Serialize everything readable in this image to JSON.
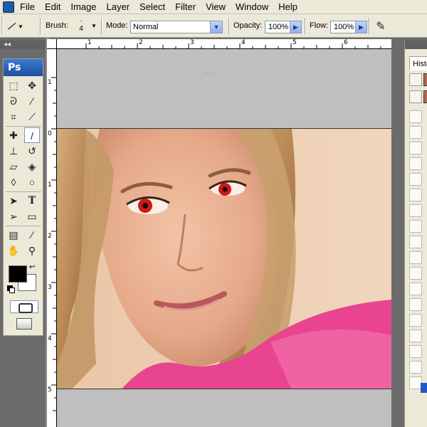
{
  "menu": {
    "items": [
      "File",
      "Edit",
      "Image",
      "Layer",
      "Select",
      "Filter",
      "View",
      "Window",
      "Help"
    ]
  },
  "options": {
    "brush_label": "Brush:",
    "brush_size": "4",
    "mode_label": "Mode:",
    "mode_value": "Normal",
    "opacity_label": "Opacity:",
    "opacity_value": "100%",
    "flow_label": "Flow:",
    "flow_value": "100%"
  },
  "toolbox": {
    "logo": "Ps"
  },
  "rulers": {
    "top": [
      "1",
      "2",
      "3",
      "4",
      "5",
      "6"
    ],
    "left": [
      "1",
      "0",
      "1",
      "2",
      "3",
      "4",
      "5"
    ]
  },
  "palette": {
    "tab": "History"
  },
  "colors": {
    "foreground": "#000000",
    "background": "#ffffff",
    "accent": "#1d4f9e"
  }
}
